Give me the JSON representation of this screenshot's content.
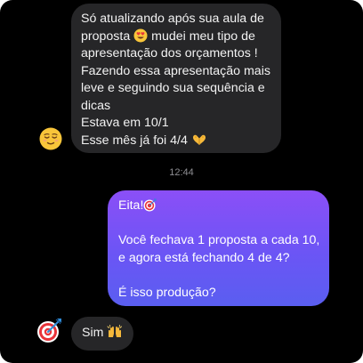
{
  "conversation": {
    "incoming_message": {
      "lines": [
        "Só atualizando após sua aula de",
        "proposta",
        "mudei meu tipo de",
        "apresentação dos orçamentos !",
        "Fazendo essa apresentação mais",
        "leve e seguindo sua sequência e",
        "dicas",
        "Estava em 10/1",
        "Esse mês já foi 4/4"
      ]
    },
    "timestamp": "12:44",
    "outgoing_message": {
      "lines": [
        "Eita!",
        "Você fechava 1 proposta a cada 10,",
        "e agora está fechando 4 de 4?",
        "É isso produção?"
      ]
    },
    "reply_message": {
      "text": "Sim"
    }
  },
  "icons": {
    "avatar_1": "relieved-face-emoji",
    "avatar_2": "bullseye-dart-emoji",
    "inline_1": "heart-eyes-emoji",
    "inline_2": "heart-hands-emoji",
    "inline_3": "bullseye-emoji",
    "inline_4": "raising-hands-emoji"
  },
  "colors": {
    "background": "#000000",
    "incoming_bubble": "#262628",
    "outgoing_gradient_top": "#8b4ff7",
    "outgoing_gradient_bottom": "#5a5ef0",
    "timestamp": "#8e8e93"
  }
}
